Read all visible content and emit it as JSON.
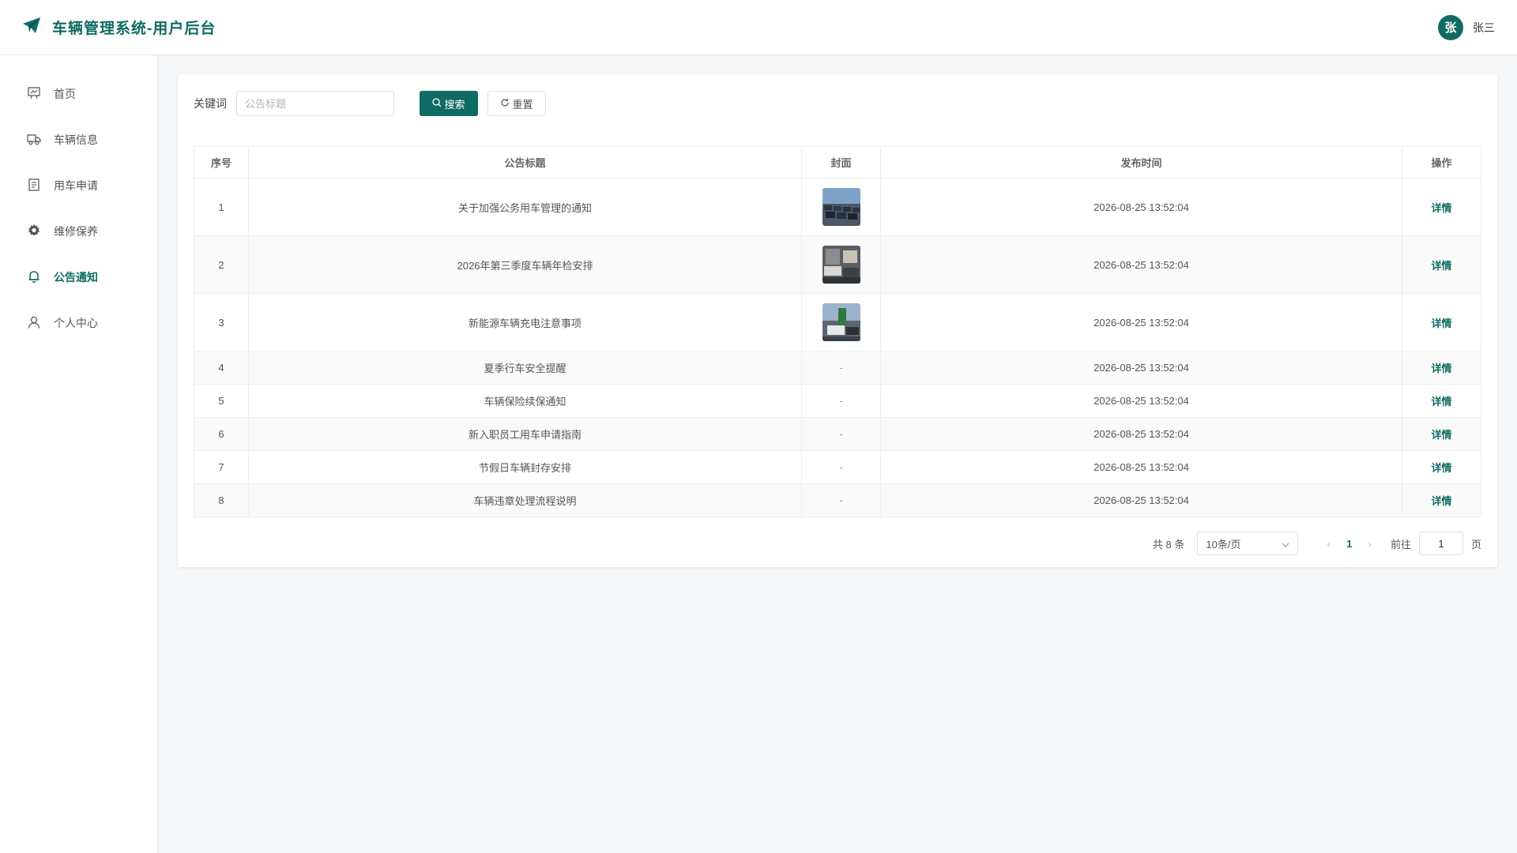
{
  "header": {
    "title": "车辆管理系统-用户后台",
    "logo_icon": "paper-plane-icon",
    "user_avatar_char": "张",
    "user_name": "张三"
  },
  "sidebar": {
    "items": [
      {
        "label": "首页",
        "icon": "dashboard-icon",
        "active": false
      },
      {
        "label": "车辆信息",
        "icon": "truck-icon",
        "active": false
      },
      {
        "label": "用车申请",
        "icon": "document-icon",
        "active": false
      },
      {
        "label": "维修保养",
        "icon": "gear-icon",
        "active": false
      },
      {
        "label": "公告通知",
        "icon": "bell-icon",
        "active": true
      },
      {
        "label": "个人中心",
        "icon": "user-icon",
        "active": false
      }
    ]
  },
  "search": {
    "label": "关键词",
    "placeholder": "公告标题",
    "value": "",
    "search_button": "搜索",
    "reset_button": "重置"
  },
  "table": {
    "headers": [
      "序号",
      "公告标题",
      "封面",
      "发布时间",
      "操作"
    ],
    "rows": [
      {
        "index": "1",
        "title": "关于加强公务用车管理的通知",
        "cover": "image",
        "time": "2026-08-25 13:52:04",
        "action": "详情"
      },
      {
        "index": "2",
        "title": "2026年第三季度车辆年检安排",
        "cover": "image",
        "time": "2026-08-25 13:52:04",
        "action": "详情"
      },
      {
        "index": "3",
        "title": "新能源车辆充电注意事项",
        "cover": "image",
        "time": "2026-08-25 13:52:04",
        "action": "详情"
      },
      {
        "index": "4",
        "title": "夏季行车安全提醒",
        "cover": "-",
        "time": "2026-08-25 13:52:04",
        "action": "详情"
      },
      {
        "index": "5",
        "title": "车辆保险续保通知",
        "cover": "-",
        "time": "2026-08-25 13:52:04",
        "action": "详情"
      },
      {
        "index": "6",
        "title": "新入职员工用车申请指南",
        "cover": "-",
        "time": "2026-08-25 13:52:04",
        "action": "详情"
      },
      {
        "index": "7",
        "title": "节假日车辆封存安排",
        "cover": "-",
        "time": "2026-08-25 13:52:04",
        "action": "详情"
      },
      {
        "index": "8",
        "title": "车辆违章处理流程说明",
        "cover": "-",
        "time": "2026-08-25 13:52:04",
        "action": "详情"
      }
    ]
  },
  "pagination": {
    "total": "共 8 条",
    "page_size": "10条/页",
    "current_page": "1",
    "goto_label": "前往",
    "goto_value": "1",
    "goto_suffix": "页"
  },
  "colors": {
    "accent": "#0f6b63"
  }
}
